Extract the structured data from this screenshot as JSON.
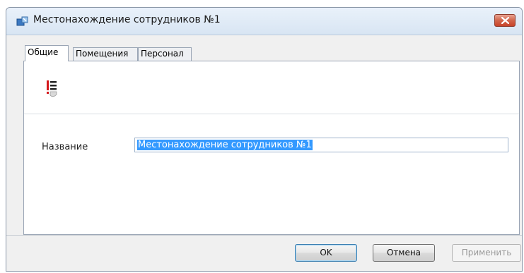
{
  "window": {
    "title": "Местонахождение сотрудников №1"
  },
  "tabs": [
    {
      "label": "Общие",
      "active": true
    },
    {
      "label": "Помещения",
      "active": false
    },
    {
      "label": "Персонал",
      "active": false
    }
  ],
  "form": {
    "name_label": "Название",
    "name_value": "Местонахождение сотрудников №1"
  },
  "buttons": {
    "ok": "OK",
    "cancel": "Отмена",
    "apply": "Применить"
  },
  "icons": {
    "app": "location-dialog-icon",
    "general": "document-list-icon",
    "close": "close-icon"
  },
  "colors": {
    "selection": "#3399ff",
    "close_button": "#c7442a"
  }
}
